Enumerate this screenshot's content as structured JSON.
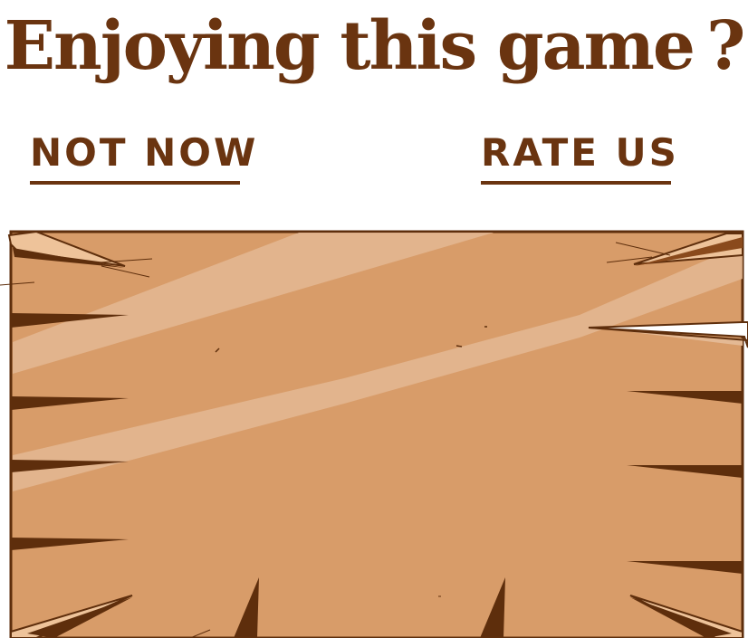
{
  "dialog": {
    "title": "Enjoying this game",
    "title_mark": "?",
    "not_now_label": "NOT NOW",
    "rate_us_label": "RATE US"
  },
  "colors": {
    "text_brown": "#6a3410",
    "board_fill": "#d89c69",
    "board_edge": "#5e2e0c",
    "board_highlight": "#e4b994",
    "board_light_edge": "#eec39a"
  },
  "icons": {
    "board": "wooden-plank-board"
  }
}
